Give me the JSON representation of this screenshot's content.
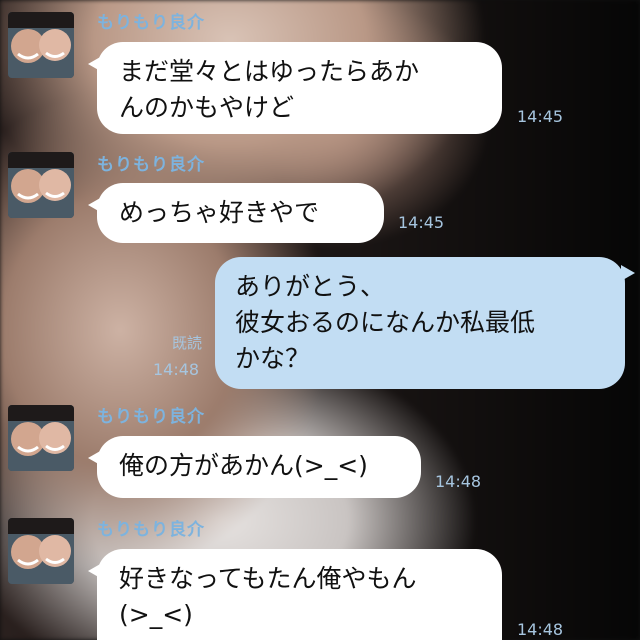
{
  "chat": {
    "messages": [
      {
        "sender": "もりもり良介",
        "text": "まだ堂々とはゆったらあか\nんのかもやけど",
        "time": "14:45"
      },
      {
        "sender": "もりもり良介",
        "text": "めっちゃ好きやで",
        "time": "14:45"
      },
      {
        "text": "ありがとう、\n彼女おるのになんか私最低\nかな？",
        "read": "既読",
        "time": "14:48"
      },
      {
        "sender": "もりもり良介",
        "text": "俺の方があかん(>_<)",
        "time": "14:48"
      },
      {
        "sender": "もりもり良介",
        "text": "好きなってもたん俺やもん\n(>_<)",
        "time": "14:48"
      }
    ]
  }
}
